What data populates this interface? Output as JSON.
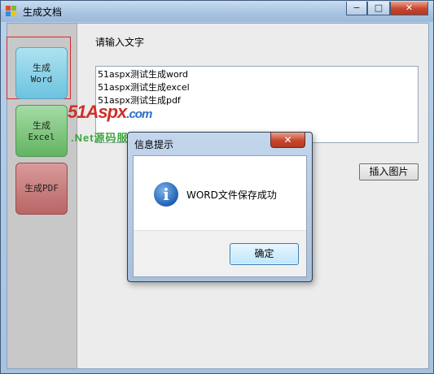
{
  "window": {
    "title": "生成文档",
    "minimize_glyph": "−",
    "maximize_glyph": "□",
    "close_glyph": "✕"
  },
  "sidebar": {
    "buttons": [
      {
        "line1": "生成",
        "line2": "Word",
        "color": "#6cc3df"
      },
      {
        "line1": "生成",
        "line2": "Excel",
        "color": "#62b462"
      },
      {
        "line1": "生成PDF",
        "line2": "",
        "color": "#b96565"
      }
    ]
  },
  "main": {
    "label": "请输入文字",
    "text_lines": [
      "51aspx测试生成word",
      "51aspx测试生成excel",
      "51aspx测试生成pdf"
    ],
    "insert_image_label": "插入图片"
  },
  "watermark": {
    "brand_main": "51Aspx",
    "brand_suffix": ".com",
    "slogan": ".Net源码服务专家"
  },
  "dialog": {
    "title": "信息提示",
    "close_glyph": "✕",
    "icon": "info-icon",
    "message": "WORD文件保存成功",
    "ok_label": "确定"
  }
}
